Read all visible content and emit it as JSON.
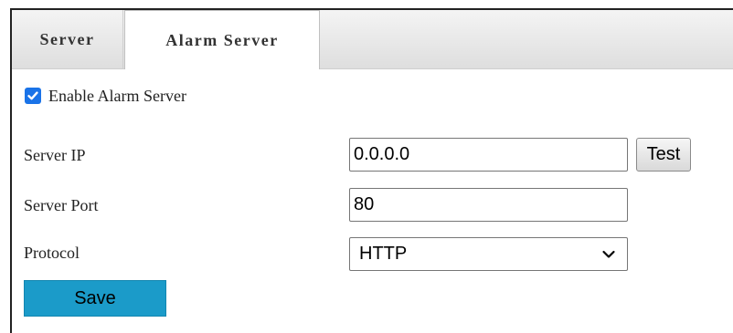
{
  "tabs": [
    {
      "label": "Server",
      "active": false
    },
    {
      "label": "Alarm Server",
      "active": true
    }
  ],
  "form": {
    "enable": {
      "label": "Enable Alarm Server",
      "checked": true
    },
    "server_ip": {
      "label": "Server IP",
      "value": "0.0.0.0"
    },
    "test_label": "Test",
    "server_port": {
      "label": "Server Port",
      "value": "80"
    },
    "protocol": {
      "label": "Protocol",
      "value": "HTTP"
    },
    "save_label": "Save"
  },
  "colors": {
    "checkbox": "#1a73e8",
    "save_button": "#1b9bc9",
    "tab_bar": "#e6e6e6"
  }
}
